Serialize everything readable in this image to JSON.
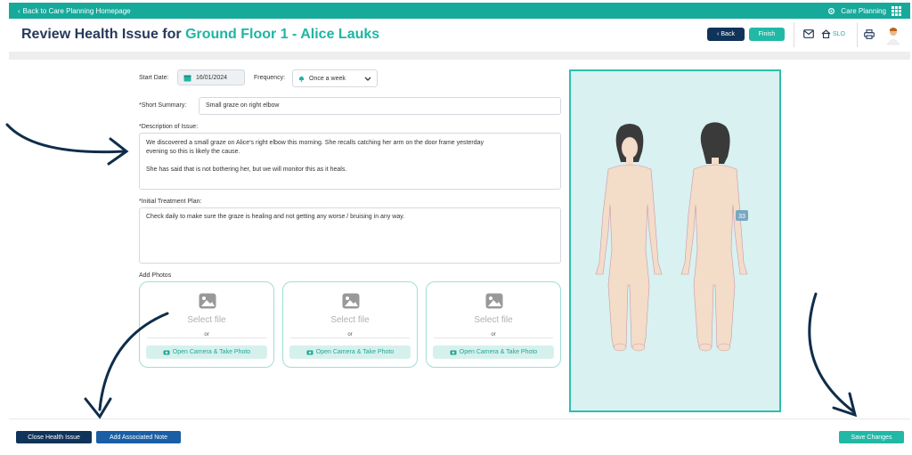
{
  "topbar": {
    "back_label": "Back to Care Planning Homepage",
    "care_planning_label": "Care Planning"
  },
  "header": {
    "title_prefix": "Review Health Issue for ",
    "title_highlight": "Ground Floor 1 - Alice Lauks",
    "back_button": "Back",
    "finish_button": "Finish",
    "home_label": "SLO"
  },
  "form": {
    "start_date_label": "Start Date:",
    "start_date_value": "16/01/2024",
    "frequency_label": "Frequency:",
    "frequency_value": "Once a week",
    "summary_label": "*Short Summary:",
    "summary_value": "Small graze on right elbow",
    "description_label": "*Description of Issue:",
    "description_line1": "We discovered a small graze on Alice's right elbow this morning. She recalls catching her arm on the door frame yesterday",
    "description_line2": "evening so this is likely the cause.",
    "description_line3": "She has said that is not bothering her, but we will monitor this as it heals.",
    "plan_label": "*Initial Treatment Plan:",
    "plan_value": "Check daily to make sure the graze is healing and not getting any worse / bruising in any way.",
    "photos_label": "Add Photos"
  },
  "photos": [
    {
      "select": "Select file",
      "or": "or",
      "camera": "Open Camera & Take Photo"
    },
    {
      "select": "Select file",
      "or": "or",
      "camera": "Open Camera & Take Photo"
    },
    {
      "select": "Select file",
      "or": "or",
      "camera": "Open Camera & Take Photo"
    }
  ],
  "body_map": {
    "marker_label": "33"
  },
  "footer": {
    "close_button": "Close Health Issue",
    "note_button": "Add Associated Note",
    "save_button": "Save Changes"
  },
  "colors": {
    "teal": "#17a99a",
    "navy": "#10335a",
    "blue": "#1a5fa6",
    "panel": "#d9f1f0"
  }
}
